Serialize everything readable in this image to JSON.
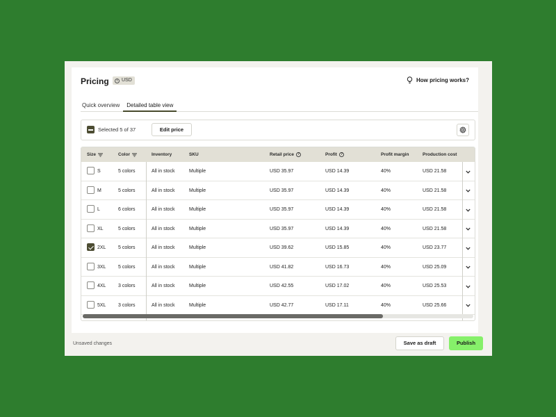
{
  "header": {
    "title": "Pricing",
    "currency": "USD",
    "help_link": "How pricing works?"
  },
  "tabs": [
    {
      "label": "Quick overview",
      "active": false
    },
    {
      "label": "Detailed table view",
      "active": true
    }
  ],
  "toolbar": {
    "selected_text": "Selected 5 of 37",
    "edit_price": "Edit price"
  },
  "table": {
    "columns": {
      "size": "Size",
      "color": "Color",
      "inventory": "Inventory",
      "sku": "SKU",
      "retail_price": "Retail price",
      "profit": "Profit",
      "profit_margin": "Profit margin",
      "production_cost": "Production cost"
    },
    "rows": [
      {
        "checked": false,
        "size": "S",
        "color": "5 colors",
        "inventory": "All in stock",
        "sku": "Multiple",
        "retail_price": "USD 35.97",
        "profit": "USD 14.39",
        "profit_margin": "40%",
        "production_cost": "USD 21.58"
      },
      {
        "checked": false,
        "size": "M",
        "color": "5 colors",
        "inventory": "All in stock",
        "sku": "Multiple",
        "retail_price": "USD 35.97",
        "profit": "USD 14.39",
        "profit_margin": "40%",
        "production_cost": "USD 21.58"
      },
      {
        "checked": false,
        "size": "L",
        "color": "6 colors",
        "inventory": "All in stock",
        "sku": "Multiple",
        "retail_price": "USD 35.97",
        "profit": "USD 14.39",
        "profit_margin": "40%",
        "production_cost": "USD 21.58"
      },
      {
        "checked": false,
        "size": "XL",
        "color": "5 colors",
        "inventory": "All in stock",
        "sku": "Multiple",
        "retail_price": "USD 35.97",
        "profit": "USD 14.39",
        "profit_margin": "40%",
        "production_cost": "USD 21.58"
      },
      {
        "checked": true,
        "size": "2XL",
        "color": "5 colors",
        "inventory": "All in stock",
        "sku": "Multiple",
        "retail_price": "USD 39.62",
        "profit": "USD 15.85",
        "profit_margin": "40%",
        "production_cost": "USD 23.77"
      },
      {
        "checked": false,
        "size": "3XL",
        "color": "5 colors",
        "inventory": "All in stock",
        "sku": "Multiple",
        "retail_price": "USD 41.82",
        "profit": "USD 16.73",
        "profit_margin": "40%",
        "production_cost": "USD 25.09"
      },
      {
        "checked": false,
        "size": "4XL",
        "color": "3 colors",
        "inventory": "All in stock",
        "sku": "Multiple",
        "retail_price": "USD 42.55",
        "profit": "USD 17.02",
        "profit_margin": "40%",
        "production_cost": "USD 25.53"
      },
      {
        "checked": false,
        "size": "5XL",
        "color": "3 colors",
        "inventory": "All in stock",
        "sku": "Multiple",
        "retail_price": "USD 42.77",
        "profit": "USD 17.11",
        "profit_margin": "40%",
        "production_cost": "USD 25.66"
      }
    ]
  },
  "footer": {
    "status": "Unsaved changes",
    "save_draft": "Save as draft",
    "publish": "Publish"
  },
  "colors": {
    "background": "#2e7d2e",
    "accent_dark": "#4c4c32",
    "publish": "#86f06a",
    "header_row": "#e2e0d6"
  },
  "icons": {
    "help": "lightbulb-icon",
    "settings": "gear-icon",
    "sort": "filter-sort-icon",
    "info": "info-circle-icon",
    "expand": "chevron-down-icon"
  }
}
